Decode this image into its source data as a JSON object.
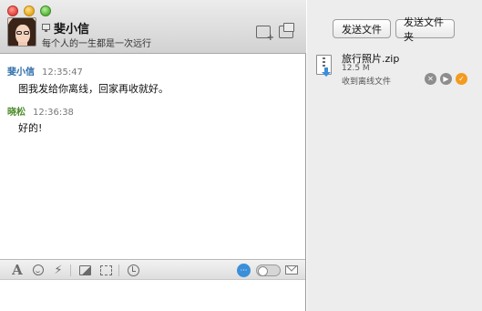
{
  "chat": {
    "contact_name": "斐小信",
    "signature": "每个人的一生都是一次远行",
    "messages": [
      {
        "sender": "斐小信",
        "time": "12:35:47",
        "text": "图我发给你离线，回家再收就好。"
      },
      {
        "sender": "晓松",
        "time": "12:36:38",
        "text": "好的!"
      }
    ],
    "toolbar": {
      "font_icon": "A",
      "shake_icon": "⚡",
      "bubble_icon": "···"
    }
  },
  "panel": {
    "send_file_label": "发送文件",
    "send_folder_label": "发送文件夹",
    "file": {
      "name": "旅行照片.zip",
      "size": "12.5 M",
      "status": "收到离线文件",
      "cancel_icon": "✕",
      "save_icon": "▶",
      "accept_icon": "✓"
    }
  },
  "colors": {
    "sender_a": "#2a6aa7",
    "sender_b": "#4d8a2a",
    "accept": "#f39b1e",
    "bubble": "#3b8fd8"
  }
}
